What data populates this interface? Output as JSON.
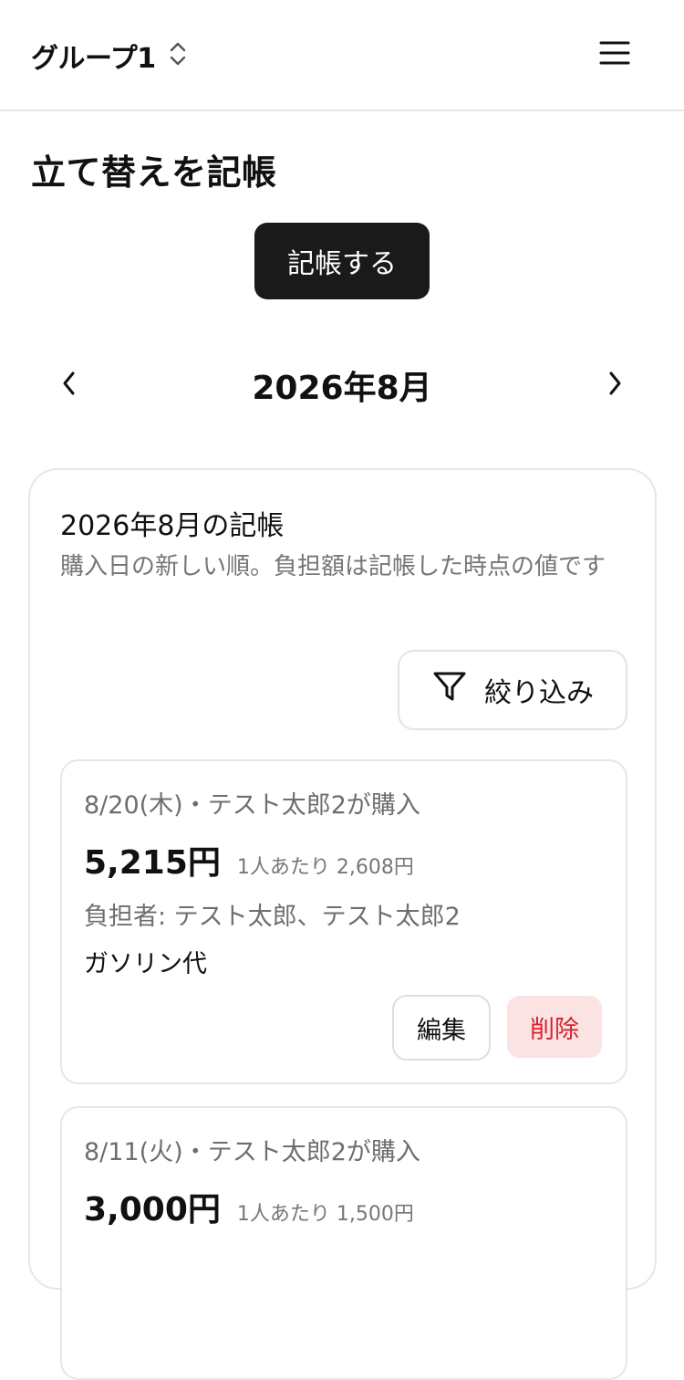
{
  "header": {
    "group_name": "グループ1",
    "switch_icon": "chevron-up-down-icon",
    "menu_icon": "hamburger-menu-icon"
  },
  "page": {
    "title": "立て替えを記帳",
    "record_button_label": "記帳する"
  },
  "month_nav": {
    "label": "2026年8月",
    "prev_icon": "chevron-left-icon",
    "next_icon": "chevron-right-icon"
  },
  "panel": {
    "title": "2026年8月の記帳",
    "description": "購入日の新しい順。負担額は記帳した時点の値です",
    "filter_label": "絞り込み",
    "filter_icon": "filter-funnel-icon"
  },
  "entries": [
    {
      "meta": "8/20(木)・テスト太郎2が購入",
      "amount": "5,215円",
      "per_person": "1人あたり 2,608円",
      "payers": "負担者: テスト太郎、テスト太郎2",
      "memo": "ガソリン代",
      "edit_label": "編集",
      "delete_label": "削除"
    },
    {
      "meta": "8/11(火)・テスト太郎2が購入",
      "amount": "3,000円",
      "per_person": "1人あたり 1,500円"
    }
  ],
  "colors": {
    "primary": "#1a1a1a",
    "danger_text": "#d4232a",
    "danger_bg": "#fbe3e3",
    "muted_text": "#6e6e6e",
    "border": "#e6e6e6"
  }
}
